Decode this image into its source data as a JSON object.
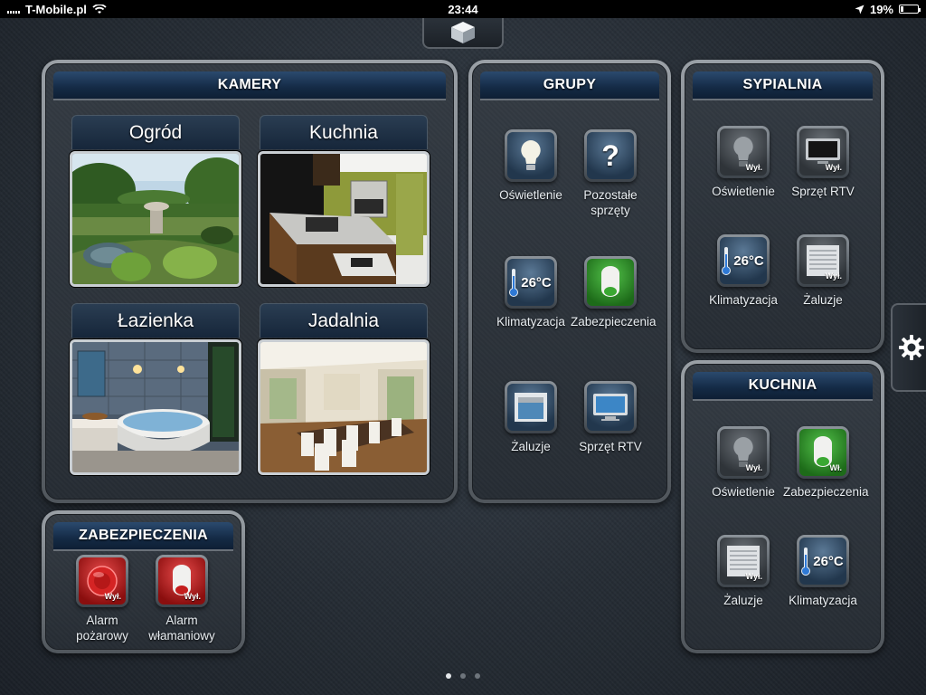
{
  "status_bar": {
    "carrier": "T-Mobile.pl",
    "time": "23:44",
    "battery_text": "19%",
    "battery_level": 0.19
  },
  "kamery": {
    "title": "KAMERY",
    "cameras": [
      {
        "label": "Ogród"
      },
      {
        "label": "Kuchnia"
      },
      {
        "label": "Łazienka"
      },
      {
        "label": "Jadalnia"
      }
    ]
  },
  "grupy": {
    "title": "GRUPY",
    "items": [
      {
        "label": "Oświetlenie",
        "icon": "lightbulb-icon"
      },
      {
        "label": "Pozostałe sprzęty",
        "icon": "question-icon"
      },
      {
        "label": "Klimatyzacja",
        "icon": "thermometer-icon",
        "value": "26°C"
      },
      {
        "label": "Zabezpieczenia",
        "icon": "siren-icon"
      },
      {
        "label": "Żaluzje",
        "icon": "blinds-icon"
      },
      {
        "label": "Sprzęt RTV",
        "icon": "tv-icon"
      }
    ]
  },
  "sypialnia": {
    "title": "SYPIALNIA",
    "items": [
      {
        "label": "Oświetlenie",
        "icon": "lightbulb-icon",
        "state": "Wył."
      },
      {
        "label": "Sprzęt RTV",
        "icon": "tv-icon",
        "state": "Wył."
      },
      {
        "label": "Klimatyzacja",
        "icon": "thermometer-icon",
        "value": "26°C"
      },
      {
        "label": "Żaluzje",
        "icon": "blinds-icon",
        "state": "Wył."
      }
    ]
  },
  "kuchnia": {
    "title": "KUCHNIA",
    "items": [
      {
        "label": "Oświetlenie",
        "icon": "lightbulb-icon",
        "state": "Wył."
      },
      {
        "label": "Zabezpieczenia",
        "icon": "siren-icon",
        "state": "Wł."
      },
      {
        "label": "Żaluzje",
        "icon": "blinds-icon",
        "state": "Wył."
      },
      {
        "label": "Klimatyzacja",
        "icon": "thermometer-icon",
        "value": "26°C"
      }
    ]
  },
  "zabezpieczenia": {
    "title": "ZABEZPIECZENIA",
    "items": [
      {
        "label": "Alarm pożarowy",
        "icon": "fire-alarm-icon",
        "state": "Wył."
      },
      {
        "label": "Alarm włamaniowy",
        "icon": "burglar-alarm-icon",
        "state": "Wył."
      }
    ]
  },
  "pagination": {
    "current_page": 1,
    "total_pages": 3
  },
  "colors": {
    "header_blue": "#142a45",
    "active_green": "#3aa832",
    "alarm_red": "#c41e1e"
  }
}
